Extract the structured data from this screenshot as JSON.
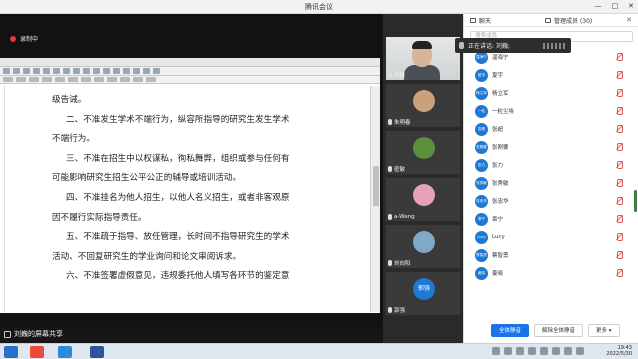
{
  "window": {
    "title": "腾讯会议"
  },
  "recording": {
    "label": "录制中"
  },
  "document": {
    "lines": [
      "级告诫。",
      "二、不准发生学术不端行为，纵容所指导的研究生发生学术",
      "不端行为。",
      "三、不准在招生中以权谋私，徇私舞弊，组织或参与任何有",
      "可能影响研究生招生公平公正的辅导或培训活动。",
      "四、不准挂名为他人招生，以他人名义招生，或者非客观原",
      "因不履行实际指导责任。",
      "五、不准疏于指导、放任管理，长时间不指导研究生的学术",
      "活动、不回复研究生的学业询问和论文审阅诉求。",
      "六、不准签署虚假意见，违规委托他人填写各环节的鉴定意"
    ]
  },
  "share": {
    "label": "刘巍的屏幕共享"
  },
  "videos": [
    {
      "name": "刘巍",
      "type": "camera"
    },
    {
      "name": "朱明春",
      "type": "avatar",
      "color": "#c9a27c"
    },
    {
      "name": "密敏",
      "type": "avatar",
      "color": "#5d8f3f"
    },
    {
      "name": "a-Wang",
      "type": "avatar",
      "color": "#e7a1b8"
    },
    {
      "name": "刘向阳",
      "type": "avatar",
      "color": "#7fa9c9"
    },
    {
      "name": "郭强",
      "type": "avatar",
      "color": "#1f78d1",
      "initials": "郭强"
    }
  ],
  "talking": {
    "label": "正在讲话: 刘巍;"
  },
  "panel": {
    "tabs": [
      {
        "label": "聊天",
        "icon": "chat-icon"
      },
      {
        "label": "管理成员 (30)",
        "icon": "members-icon"
      }
    ],
    "search_placeholder": "搜索成员",
    "participants": [
      {
        "name": "温海宁",
        "avatar": "温海宁"
      },
      {
        "name": "夏宇",
        "avatar": "夏宇"
      },
      {
        "name": "杨立军",
        "avatar": "杨立军"
      },
      {
        "name": "一粒尘埃",
        "avatar": "一粒"
      },
      {
        "name": "张超",
        "avatar": "张超"
      },
      {
        "name": "张刚要",
        "avatar": "张刚要"
      },
      {
        "name": "张力",
        "avatar": "张力"
      },
      {
        "name": "张秀敏",
        "avatar": "张秀敏"
      },
      {
        "name": "张忠华",
        "avatar": "张忠华"
      },
      {
        "name": "章宁",
        "avatar": "章宁"
      },
      {
        "name": "Lucy",
        "avatar": "Lucy"
      },
      {
        "name": "蔡智勇",
        "avatar": "蔡智勇"
      },
      {
        "name": "姜晓",
        "avatar": "姜晓"
      }
    ],
    "footer": {
      "mute_all": "全体静音",
      "unmute_all": "解除全体静音",
      "more": "更多 ▾"
    }
  },
  "taskbar": {
    "time": "19:43",
    "date": "2022/5/30"
  }
}
